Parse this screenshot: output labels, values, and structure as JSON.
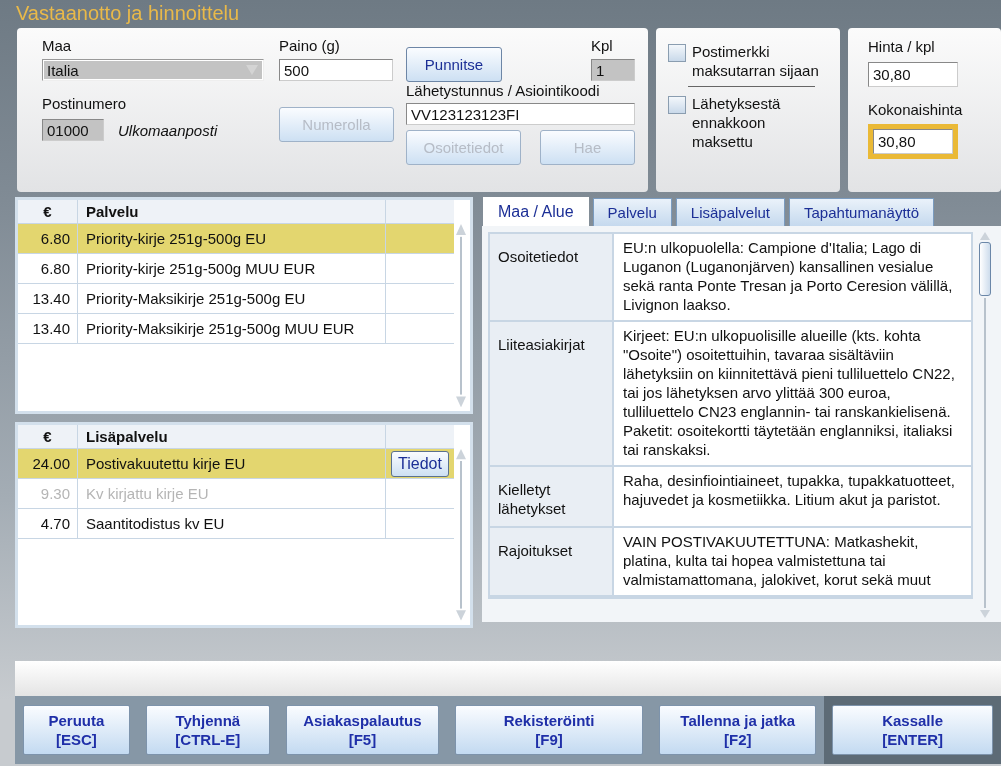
{
  "title": "Vastaanotto ja hinnoittelu",
  "shipment": {
    "country_label": "Maa",
    "country_value": "Italia",
    "postcode_label": "Postinumero",
    "postcode_value": "01000",
    "postcode_area": "Ulkomaanposti",
    "weight_label": "Paino (g)",
    "weight_value": "500",
    "qty_label": "Kpl",
    "qty_value": "1",
    "tracking_label": "Lähetystunnus / Asiointikoodi",
    "tracking_value": "VV123123123FI",
    "weigh_button": {
      "label": "Punnitse",
      "disabled": false
    },
    "number_button": {
      "label": "Numerolla",
      "disabled": true
    },
    "address_button": {
      "label": "Osoitetiedot",
      "disabled": true
    },
    "fetch_button": {
      "label": "Hae",
      "disabled": true
    }
  },
  "options": [
    {
      "label": "Postimerkki maksutarran sijaan",
      "checked": false
    },
    {
      "label": "Lähetyksestä ennakkoon maksettu",
      "checked": false
    }
  ],
  "price": {
    "unit_label": "Hinta / kpl",
    "unit_value": "30,80",
    "total_label": "Kokonaishinta",
    "total_value": "30,80",
    "total_highlighted": true
  },
  "services": {
    "columns": [
      "€",
      "Palvelu"
    ],
    "rows": [
      {
        "price": "6.80",
        "name": "Priority-kirje 251g-500g EU",
        "selected": true,
        "disabled": false
      },
      {
        "price": "6.80",
        "name": "Priority-kirje 251g-500g MUU EUR",
        "selected": false,
        "disabled": false
      },
      {
        "price": "13.40",
        "name": "Priority-Maksikirje 251g-500g EU",
        "selected": false,
        "disabled": false
      },
      {
        "price": "13.40",
        "name": "Priority-Maksikirje 251g-500g MUU EUR",
        "selected": false,
        "disabled": false
      }
    ]
  },
  "extras": {
    "columns": [
      "€",
      "Lisäpalvelu"
    ],
    "rows": [
      {
        "price": "24.00",
        "name": "Postivakuutettu kirje EU",
        "selected": true,
        "disabled": false,
        "action": "Tiedot"
      },
      {
        "price": "9.30",
        "name": "Kv kirjattu kirje EU",
        "selected": false,
        "disabled": true
      },
      {
        "price": "4.70",
        "name": "Saantitodistus kv EU",
        "selected": false,
        "disabled": false
      }
    ]
  },
  "tabs": [
    {
      "label": "Maa / Alue",
      "selected": true
    },
    {
      "label": "Palvelu",
      "selected": false
    },
    {
      "label": "Lisäpalvelut",
      "selected": false
    },
    {
      "label": "Tapahtumanäyttö",
      "selected": false
    }
  ],
  "info_rows": [
    {
      "label": "Osoitetiedot",
      "text": "EU:n ulkopuolella: Campione d'Italia; Lago di Luganon (Luganonjärven) kansallinen vesialue sekä ranta Ponte Tresan ja Porto Ceresion välillä, Livignon laakso."
    },
    {
      "label": "Liiteasiakirjat",
      "text": "Kirjeet: EU:n ulkopuolisille alueille (kts. kohta \"Osoite\") osoitettuihin, tavaraa sisältäviin lähetyksiin on kiinnitettävä pieni tulliluettelo CN22, tai jos lähetyksen arvo ylittää 300 euroa, tulliluettelo CN23 englannin- tai ranskankielisenä. Paketit: osoitekortti täytetään englanniksi, italiaksi tai ranskaksi."
    },
    {
      "label": "Kielletyt lähetykset",
      "text": "Raha, desinfiointiaineet, tupakka, tupakkatuotteet, hajuvedet ja kosmetiikka. Litium akut ja paristot."
    },
    {
      "label": "Rajoitukset",
      "text": "VAIN POSTIVAKUUTETTUNA: Matkashekit, platina, kulta tai hopea valmistettuna tai valmistamattomana, jalokivet, korut sekä muut"
    }
  ],
  "footer_buttons": [
    {
      "label": "Peruuta",
      "key": "[ESC]",
      "primary": false
    },
    {
      "label": "Tyhjennä",
      "key": "[CTRL-E]",
      "primary": false
    },
    {
      "label": "Asiakaspalautus",
      "key": "[F5]",
      "primary": false
    },
    {
      "label": "Rekisteröinti",
      "key": "[F9]",
      "primary": false
    },
    {
      "label": "Tallenna ja jatka",
      "key": "[F2]",
      "primary": false
    },
    {
      "label": "Kassalle",
      "key": "[ENTER]",
      "primary": true
    }
  ]
}
